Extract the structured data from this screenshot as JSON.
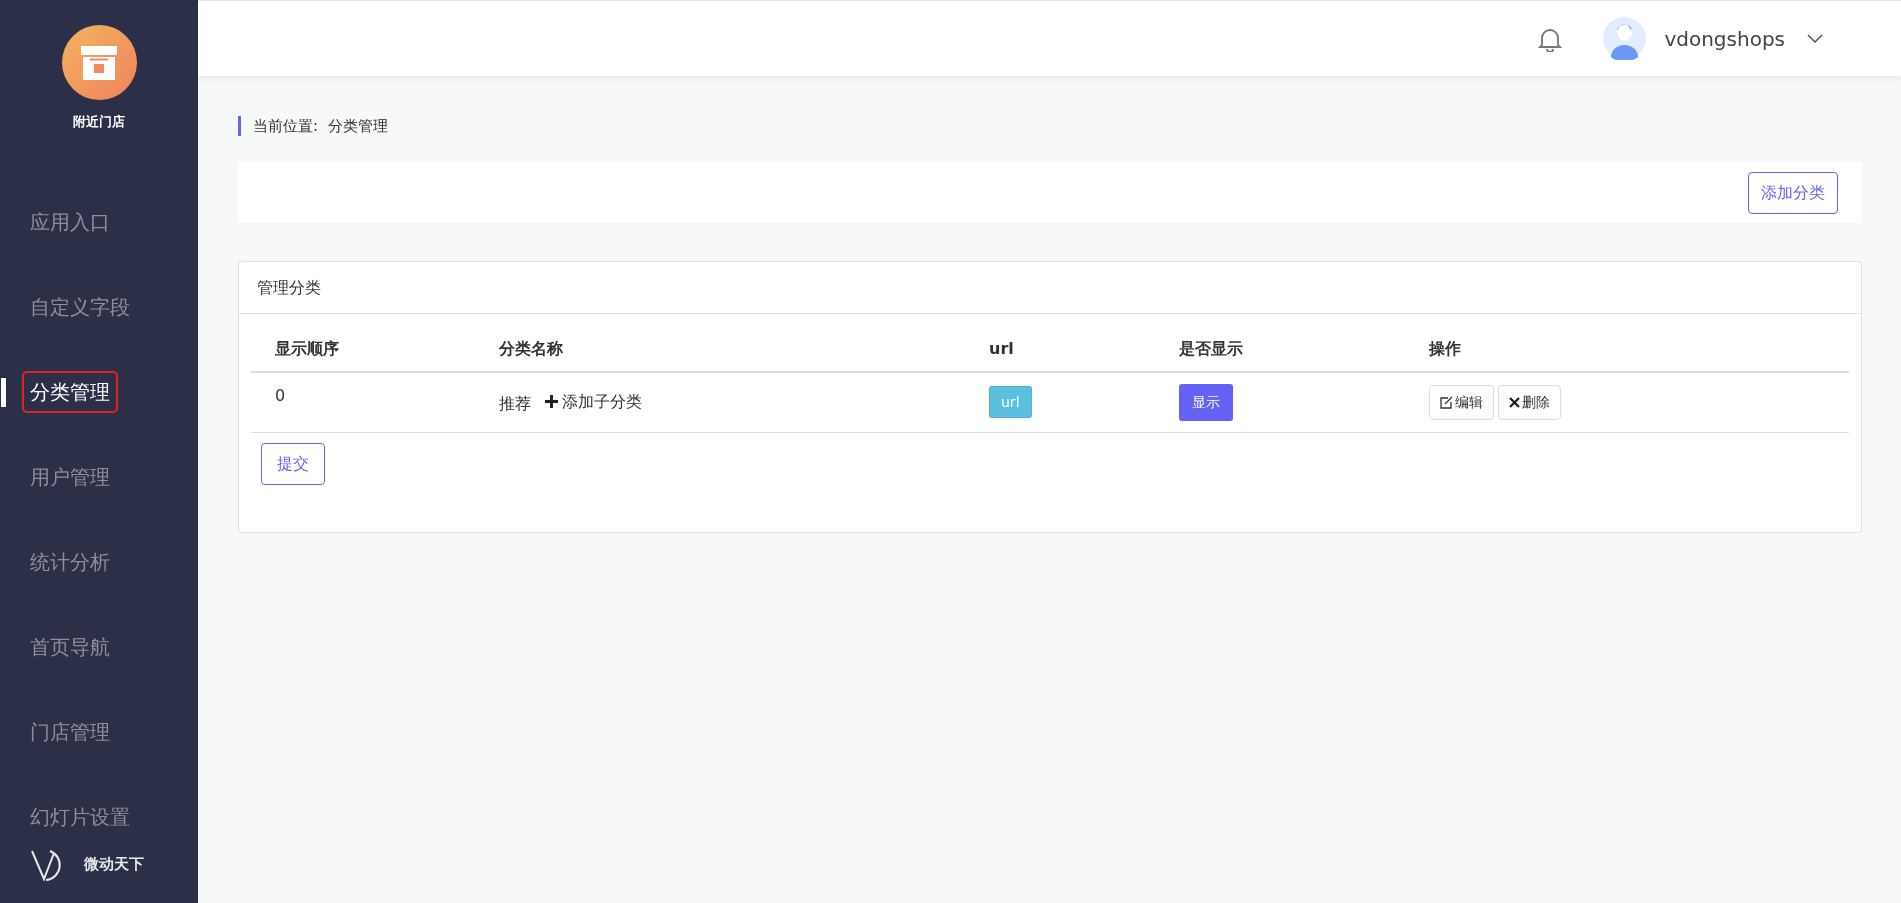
{
  "sidebar": {
    "store_name": "附近门店",
    "items": [
      {
        "label": "应用入口",
        "selected": false
      },
      {
        "label": "自定义字段",
        "selected": false
      },
      {
        "label": "分类管理",
        "selected": true
      },
      {
        "label": "用户管理",
        "selected": false
      },
      {
        "label": "统计分析",
        "selected": false
      },
      {
        "label": "首页导航",
        "selected": false
      },
      {
        "label": "门店管理",
        "selected": false
      },
      {
        "label": "幻灯片设置",
        "selected": false
      }
    ],
    "brand": "微动天下"
  },
  "header": {
    "username": "vdongshops"
  },
  "breadcrumb": {
    "label": "当前位置:",
    "current": "分类管理"
  },
  "toolbar": {
    "buttons": [
      "添加分类"
    ]
  },
  "card": {
    "title": "管理分类",
    "table": {
      "columns": [
        "显示顺序",
        "分类名称",
        "url",
        "是否显示",
        "操作"
      ],
      "rows": [
        {
          "order": "0",
          "name": "推荐",
          "add_child": "添加子分类",
          "url": "url",
          "visible": "显示",
          "actions": [
            "编辑",
            "删除"
          ]
        }
      ]
    },
    "submit": "提交"
  }
}
